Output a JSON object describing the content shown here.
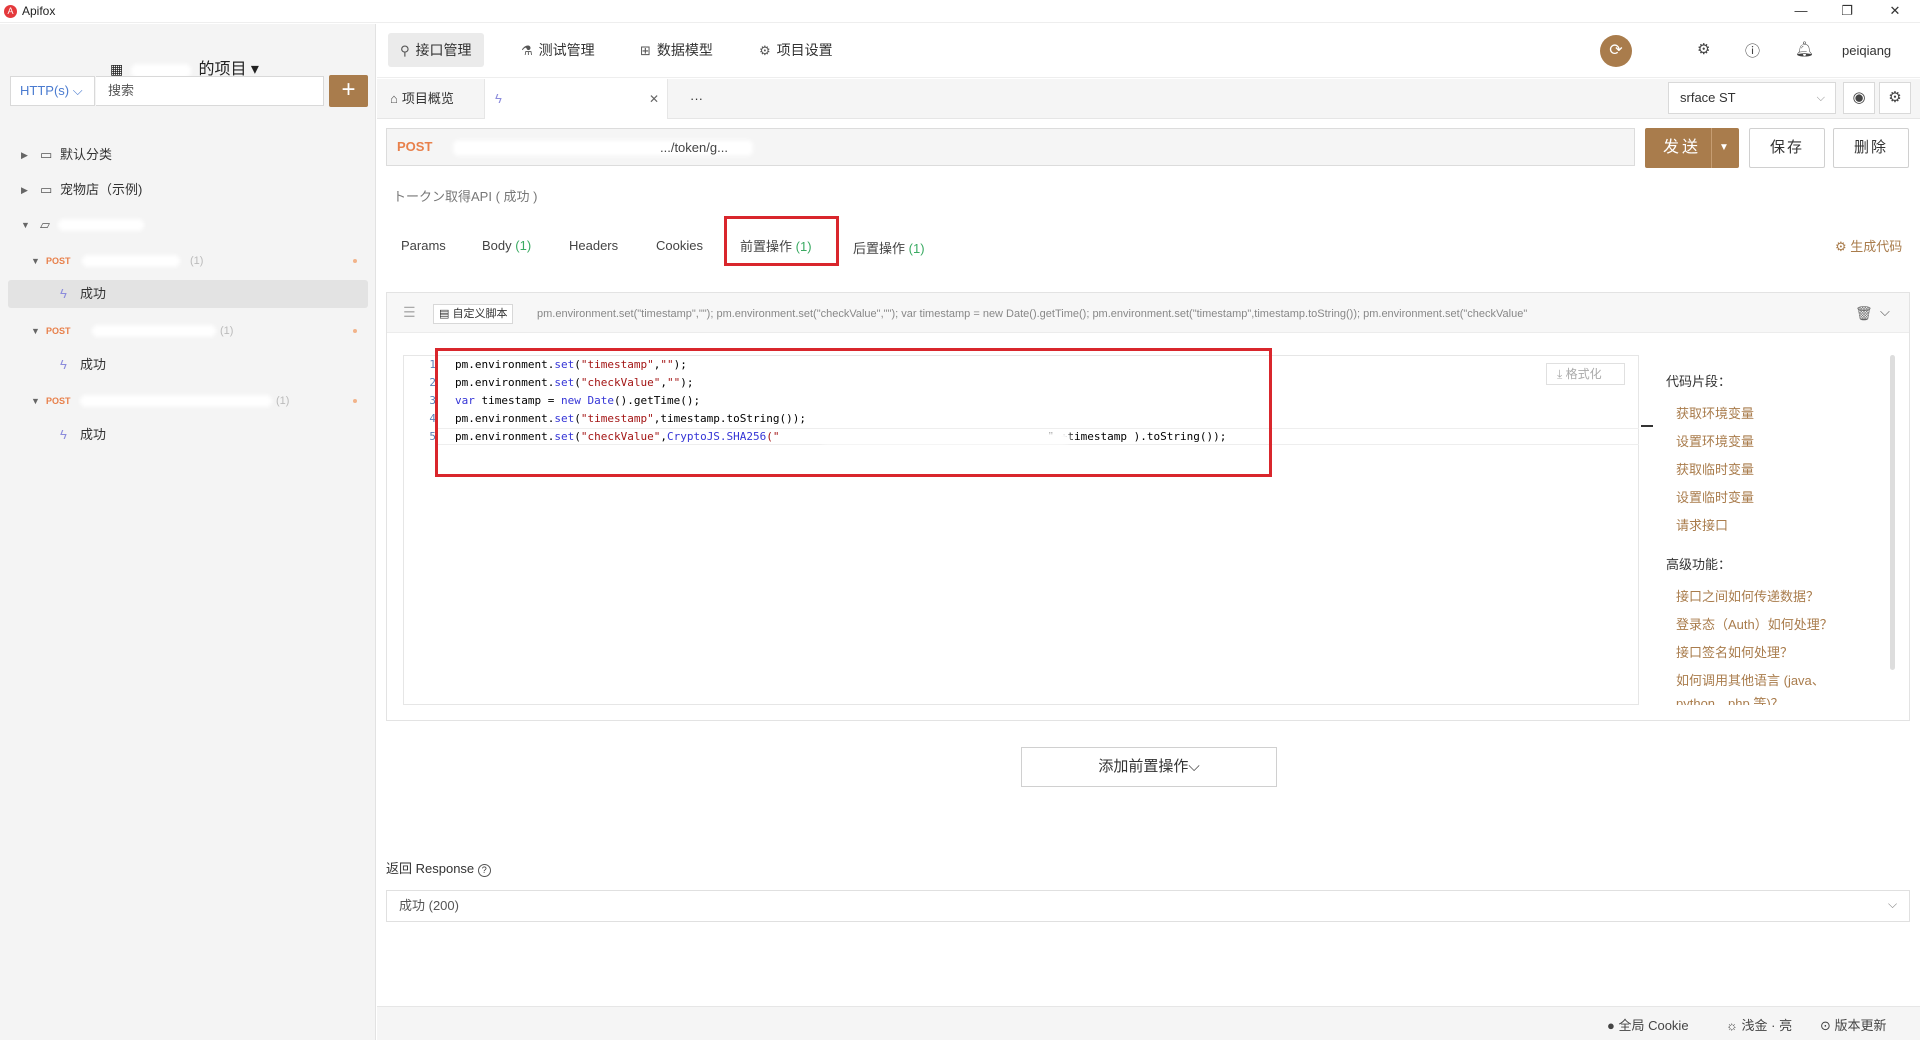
{
  "window": {
    "title": "Apifox",
    "minimize": "—",
    "maximize": "❐",
    "close": "✕"
  },
  "sidebar": {
    "project_title": "的项目 ▾",
    "method_filter": "HTTP(s) ⌵",
    "search_placeholder": "搜索",
    "add_label": "+",
    "tree": [
      {
        "label": "默认分类"
      },
      {
        "label": "宠物店（示例)"
      },
      {
        "method": "POST",
        "count": "(1)",
        "child": "成功"
      },
      {
        "method": "POST",
        "count": "(1)",
        "child": "成功"
      },
      {
        "method": "POST",
        "count": "(1)",
        "child": "成功"
      }
    ]
  },
  "topnav": {
    "items": [
      "接口管理",
      "测试管理",
      "数据模型",
      "项目设置"
    ],
    "username": "peiqiang"
  },
  "tabs": {
    "overview": "项目概览",
    "more": "···",
    "close": "✕",
    "env": "srface ST"
  },
  "request": {
    "method": "POST",
    "url_fragment": ".../token/g...",
    "send": "发送",
    "save": "保存",
    "delete": "删除",
    "api_name": "トークン取得API ( 成功 )",
    "tabs": [
      {
        "label": "Params",
        "count": ""
      },
      {
        "label": "Body",
        "count": "(1)"
      },
      {
        "label": "Headers",
        "count": ""
      },
      {
        "label": "Cookies",
        "count": ""
      },
      {
        "label": "前置操作",
        "count": "(1)"
      },
      {
        "label": "后置操作",
        "count": "(1)"
      }
    ],
    "gen_code": "生成代码"
  },
  "script": {
    "tag": "自定义脚本",
    "preview": "pm.environment.set(\"timestamp\",\"\"); pm.environment.set(\"checkValue\",\"\"); var timestamp = new Date().getTime(); pm.environment.set(\"timestamp\",timestamp.toString()); pm.environment.set(\"checkValue\"",
    "format": "格式化",
    "line_numbers": [
      "1",
      "2",
      "3",
      "4",
      "5"
    ],
    "code": {
      "l1a": "pm.environment.",
      "l1b": "set",
      "l1c": "(",
      "l1d": "\"timestamp\"",
      "l1e": ",",
      "l1f": "\"\"",
      "l1g": ");",
      "l2a": "pm.environment.",
      "l2b": "set",
      "l2c": "(",
      "l2d": "\"checkValue\"",
      "l2e": ",",
      "l2f": "\"\"",
      "l2g": ");",
      "l3a": "var",
      "l3b": " timestamp = ",
      "l3c": "new",
      "l3d": " ",
      "l3e": "Date",
      "l3f": "().getTime();",
      "l4a": "pm.environment.",
      "l4b": "set",
      "l4c": "(",
      "l4d": "\"timestamp\"",
      "l4e": ",timestamp.toString());",
      "l5a": "pm.environment.",
      "l5b": "set",
      "l5c": "(",
      "l5d": "\"checkValue\"",
      "l5e": ",",
      "l5f": "CryptoJS.SHA256",
      "l5g": "(\"",
      "l5h": "\" +timestamp ).toString());"
    }
  },
  "snippets": {
    "heading1": "代码片段：",
    "items1": [
      "获取环境变量",
      "设置环境变量",
      "获取临时变量",
      "设置临时变量",
      "请求接口"
    ],
    "heading2": "高级功能：",
    "items2": [
      "接口之间如何传递数据？",
      "登录态（Auth）如何处理？",
      "接口签名如何处理？",
      "如何调用其他语言 (java、",
      "python、php 等)？"
    ]
  },
  "add_pre_op": "添加前置操作⌵",
  "response": {
    "label": "返回 Response",
    "help": "?",
    "selected": "成功 (200)"
  },
  "statusbar": {
    "cookie": "全局 Cookie",
    "theme": "浅金 · 亮",
    "update": "版本更新"
  },
  "colors": {
    "accent": "#a97c4c",
    "post": "#e8804b",
    "highlight": "#d9262c",
    "count": "#3aaa62"
  }
}
